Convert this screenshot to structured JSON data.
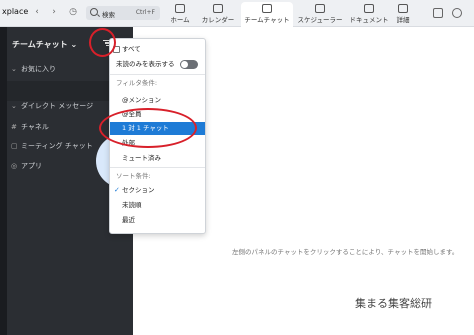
{
  "window": {
    "app_name": "xplace",
    "back_icon": "chevron-left",
    "forward_icon": "chevron-right",
    "history_icon": "clock"
  },
  "search": {
    "label": "検索",
    "shortcut": "Ctrl+F"
  },
  "tabs": [
    {
      "label": "ホーム",
      "icon": "home-icon",
      "active": false
    },
    {
      "label": "カレンダー",
      "icon": "calendar-icon",
      "active": false
    },
    {
      "label": "チームチャット",
      "icon": "chat-icon",
      "active": true
    },
    {
      "label": "スケジューラー",
      "icon": "scheduler-icon",
      "active": false
    },
    {
      "label": "ドキュメント",
      "icon": "document-icon",
      "active": false
    },
    {
      "label": "詳細",
      "icon": "more-icon",
      "active": false
    }
  ],
  "panel": {
    "title": "チームチャット",
    "items": [
      {
        "label": "お気に入り",
        "icon": "star-icon"
      },
      {
        "label": "ダイレクト メッセージ",
        "icon": "message-icon"
      },
      {
        "label": "チャネル",
        "icon": "hash-icon"
      },
      {
        "label": "ミーティング チャット",
        "icon": "meeting-icon"
      },
      {
        "label": "アプリ",
        "icon": "app-icon"
      }
    ]
  },
  "dropdown": {
    "all_label": "すべて",
    "unread_only_label": "未読のみを表示する",
    "filter_section": "フィルタ条件:",
    "filter_items": [
      "@メンション",
      "@全員",
      "1 対 1 チャット",
      "外部",
      "ミュート済み"
    ],
    "selected_filter": "1 対 1 チャット",
    "sort_section": "ソート条件:",
    "sort_items": [
      "セクション",
      "未読順",
      "最近"
    ],
    "selected_sort": "セクション"
  },
  "main": {
    "hint": "左側のパネルのチャットをクリックすることにより、チャットを開始します。",
    "watermark": "集まる集客総研"
  },
  "colors": {
    "accent": "#1e7bd6",
    "annotation": "#d8202a",
    "sidebar_bg": "#2b2e33",
    "bubble": "#7cb4f3"
  }
}
